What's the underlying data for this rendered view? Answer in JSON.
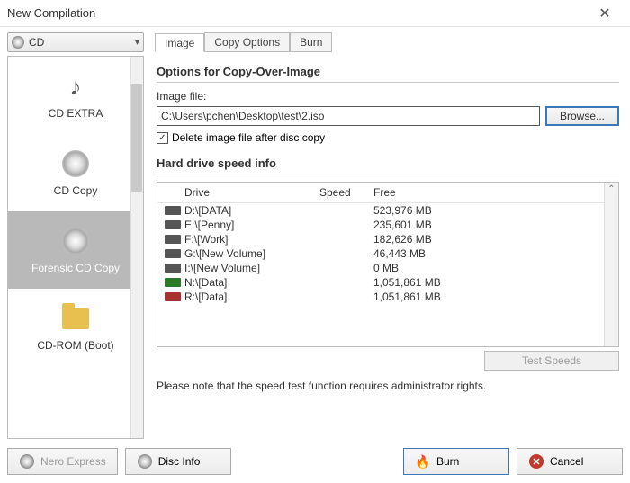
{
  "window": {
    "title": "New Compilation"
  },
  "combo": {
    "label": "CD"
  },
  "tabs": [
    {
      "label": "Image",
      "active": true
    },
    {
      "label": "Copy Options",
      "active": false
    },
    {
      "label": "Burn",
      "active": false
    }
  ],
  "sidebar": {
    "items": [
      {
        "label": "CD EXTRA",
        "selected": false
      },
      {
        "label": "CD Copy",
        "selected": false
      },
      {
        "label": "Forensic CD Copy",
        "selected": true
      },
      {
        "label": "CD-ROM (Boot)",
        "selected": false
      }
    ]
  },
  "image_panel": {
    "heading": "Options for Copy-Over-Image",
    "file_label": "Image file:",
    "file_value": "C:\\Users\\pchen\\Desktop\\test\\2.iso",
    "browse": "Browse...",
    "delete_cb": "Delete image file after disc copy",
    "delete_checked": true
  },
  "drives_panel": {
    "heading": "Hard drive speed info",
    "columns": {
      "drive": "Drive",
      "speed": "Speed",
      "free": "Free"
    },
    "rows": [
      {
        "drive": "D:\\[DATA]",
        "speed": "",
        "free": "523,976 MB",
        "ic": "b"
      },
      {
        "drive": "E:\\[Penny]",
        "speed": "",
        "free": "235,601 MB",
        "ic": "b"
      },
      {
        "drive": "F:\\[Work]",
        "speed": "",
        "free": "182,626 MB",
        "ic": "b"
      },
      {
        "drive": "G:\\[New Volume]",
        "speed": "",
        "free": "46,443 MB",
        "ic": "b"
      },
      {
        "drive": "I:\\[New Volume]",
        "speed": "",
        "free": "0 MB",
        "ic": "b"
      },
      {
        "drive": "N:\\[Data]",
        "speed": "",
        "free": "1,051,861 MB",
        "ic": "g"
      },
      {
        "drive": "R:\\[Data]",
        "speed": "",
        "free": "1,051,861 MB",
        "ic": "r"
      }
    ],
    "test_button": "Test Speeds",
    "note": "Please note that the speed test function requires administrator rights."
  },
  "footer": {
    "nero": "Nero Express",
    "discinfo": "Disc Info",
    "burn": "Burn",
    "cancel": "Cancel"
  }
}
